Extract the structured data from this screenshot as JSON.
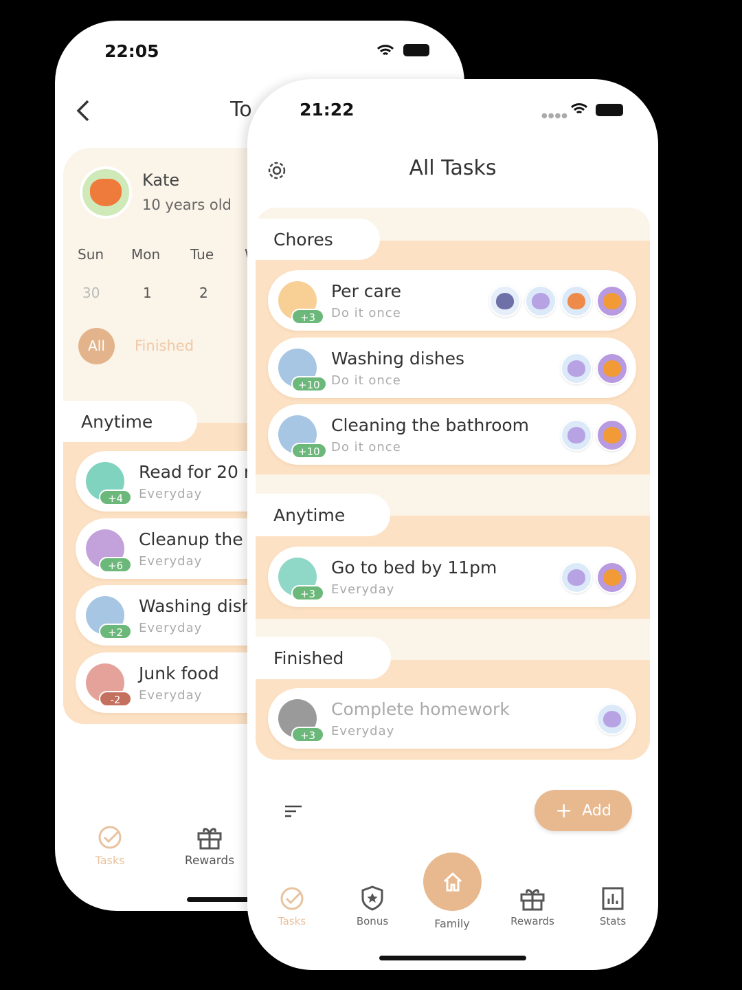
{
  "back_screen": {
    "status_time": "22:05",
    "title": "To",
    "profile": {
      "name": "Kate",
      "age": "10 years old"
    },
    "days": [
      {
        "day": "Sun",
        "date": "30"
      },
      {
        "day": "Mon",
        "date": "1"
      },
      {
        "day": "Tue",
        "date": "2"
      },
      {
        "day": "W",
        "date": ""
      }
    ],
    "filters": {
      "all": "All",
      "finished": "Finished"
    },
    "section": "Anytime",
    "tasks": [
      {
        "title": "Read for 20 m",
        "freq": "Everyday",
        "points": "+4",
        "icon": "book-icon",
        "color": "#7fd3bf"
      },
      {
        "title": "Cleanup the l",
        "freq": "Everyday",
        "points": "+6",
        "icon": "bath-icon",
        "color": "#c3a2dc"
      },
      {
        "title": "Washing dish",
        "freq": "Everyday",
        "points": "+2",
        "icon": "drop-icon",
        "color": "#a6c6e4"
      },
      {
        "title": "Junk food",
        "freq": "Everyday",
        "points": "-2",
        "icon": "no-food-icon",
        "color": "#e4a29a"
      }
    ],
    "nav": {
      "tasks": "Tasks",
      "rewards": "Rewards"
    }
  },
  "front_screen": {
    "status_time": "21:22",
    "title": "All Tasks",
    "sections": {
      "chores": "Chores",
      "anytime": "Anytime",
      "finished": "Finished"
    },
    "chores": [
      {
        "title": "Per care",
        "freq": "Do it once",
        "points": "+3",
        "icon": "cat-icon",
        "color": "#f8cf95",
        "avatars": [
          "koala",
          "hippo",
          "deer",
          "tiger"
        ]
      },
      {
        "title": "Washing dishes",
        "freq": "Do it once",
        "points": "+10",
        "icon": "drop-icon",
        "color": "#a6c6e4",
        "avatars": [
          "hippo",
          "tiger"
        ]
      },
      {
        "title": "Cleaning the bathroom",
        "freq": "Do it once",
        "points": "+10",
        "icon": "bath-icon",
        "color": "#a6c6e4",
        "avatars": [
          "hippo",
          "tiger"
        ]
      }
    ],
    "anytime": [
      {
        "title": "Go to bed by 11pm",
        "freq": "Everyday",
        "points": "+3",
        "icon": "bed-icon",
        "color": "#8fd8c8",
        "avatars": [
          "hippo",
          "tiger"
        ]
      }
    ],
    "finished": [
      {
        "title": "Complete homework",
        "freq": "Everyday",
        "points": "+3",
        "icon": "pencil-icon",
        "color": "#9a9a9a",
        "avatars": [
          "hippo"
        ]
      }
    ],
    "add_label": "Add",
    "nav": {
      "tasks": "Tasks",
      "bonus": "Bonus",
      "family": "Family",
      "rewards": "Rewards",
      "stats": "Stats"
    },
    "active_tab": "Family"
  },
  "colors": {
    "accent": "#e8b98e",
    "peach": "#fce1c4",
    "cream": "#fbf4e8",
    "badge_green": "#6cb87a"
  }
}
